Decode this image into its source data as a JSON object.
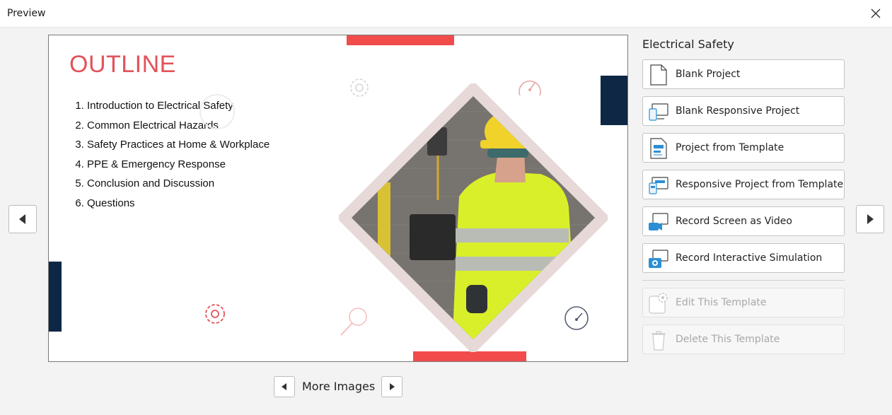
{
  "window": {
    "title": "Preview"
  },
  "slide": {
    "heading": "OUTLINE",
    "items": [
      "Introduction to Electrical Safety",
      "Common Electrical Hazards",
      "Safety Practices at Home & Workplace",
      "PPE & Emergency Response",
      "Conclusion and Discussion",
      "Questions"
    ],
    "colors": {
      "accent": "#f24b4b",
      "navy": "#0e2745",
      "frame": "#e6d9d8",
      "heading": "#e2535a"
    }
  },
  "gallery": {
    "more_images_label": "More Images"
  },
  "panel": {
    "title": "Electrical Safety",
    "actions": [
      {
        "label": "Blank Project",
        "icon": "blank-page-icon",
        "enabled": true
      },
      {
        "label": "Blank Responsive Project",
        "icon": "responsive-devices-icon",
        "enabled": true
      },
      {
        "label": "Project from Template",
        "icon": "template-page-icon",
        "enabled": true
      },
      {
        "label": "Responsive Project from Template",
        "icon": "responsive-template-icon",
        "enabled": true
      },
      {
        "label": "Record Screen as Video",
        "icon": "video-camera-icon",
        "enabled": true
      },
      {
        "label": "Record Interactive Simulation",
        "icon": "photo-camera-icon",
        "enabled": true
      }
    ],
    "template_actions": [
      {
        "label": "Edit This Template",
        "icon": "edit-gear-icon",
        "enabled": false
      },
      {
        "label": "Delete This Template",
        "icon": "trash-icon",
        "enabled": false
      }
    ]
  }
}
